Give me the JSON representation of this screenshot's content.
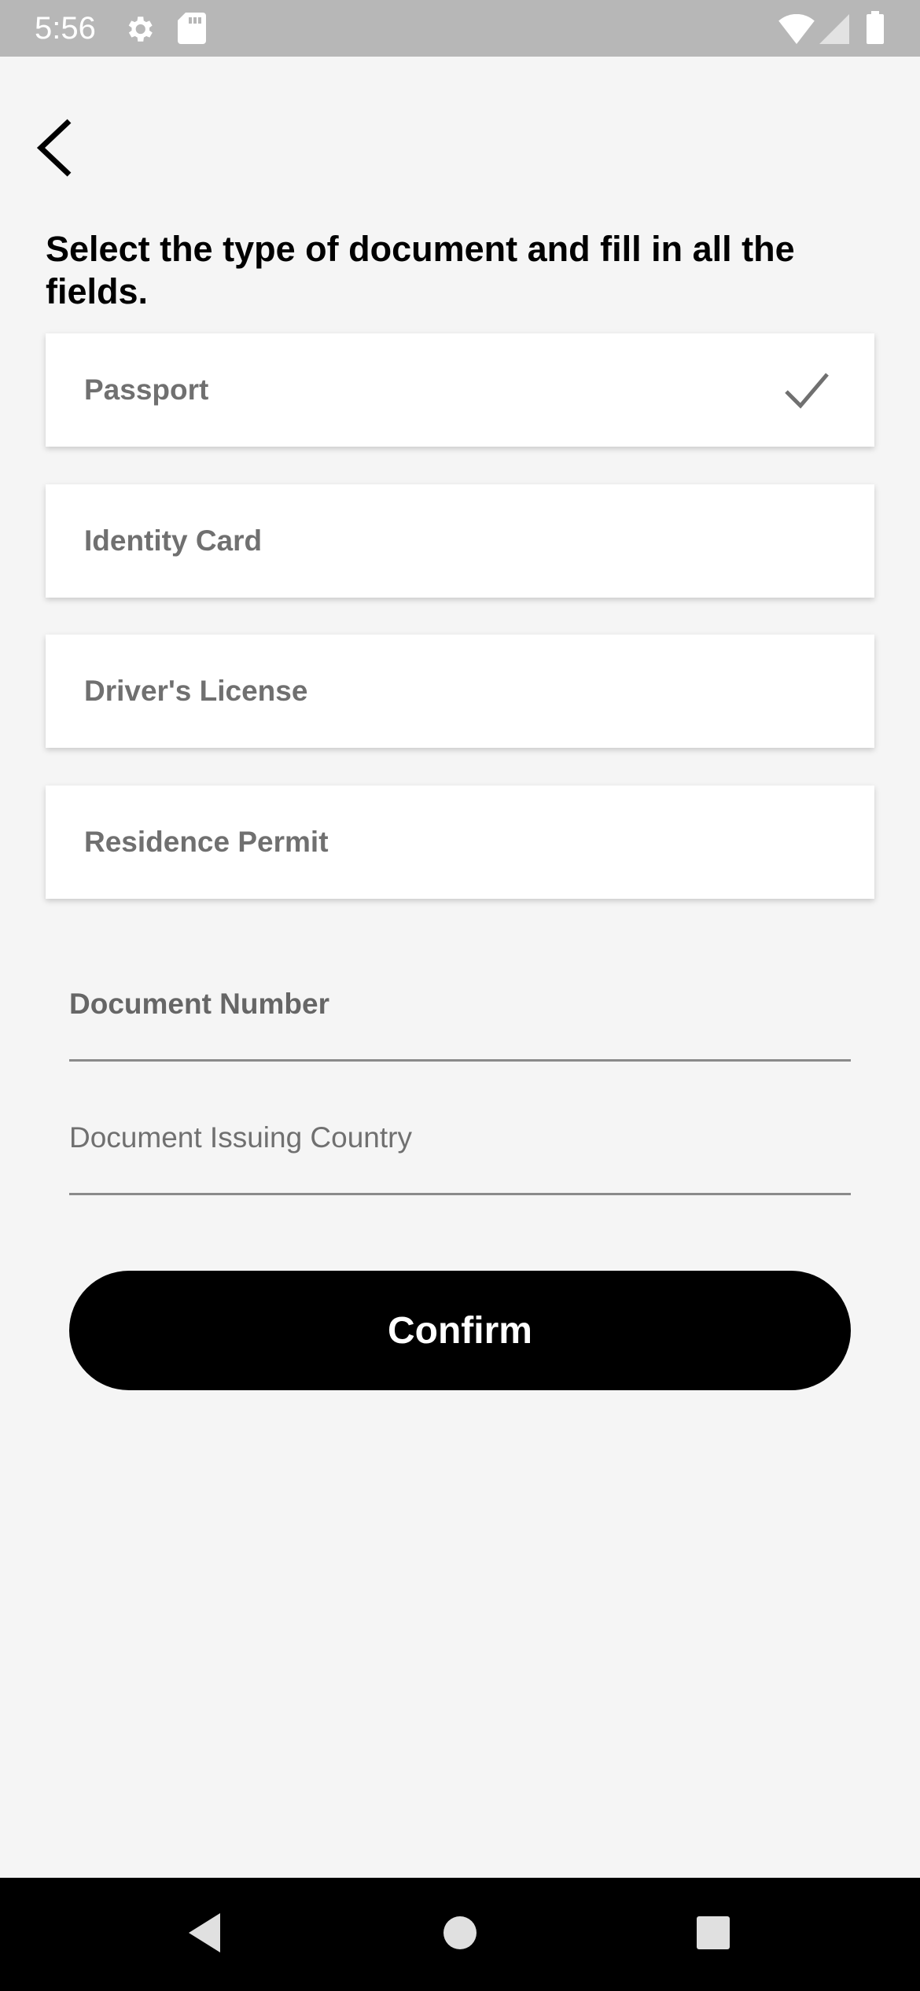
{
  "status_bar": {
    "time": "5:56",
    "icons": [
      "settings-icon",
      "sd-card-icon",
      "wifi-icon",
      "cellular-signal-icon",
      "battery-icon"
    ]
  },
  "header": {
    "back_icon": "chevron-left-icon"
  },
  "heading": "Select the type of document and fill in all the fields.",
  "document_types": [
    {
      "label": "Passport",
      "selected": true
    },
    {
      "label": "Identity Card",
      "selected": false
    },
    {
      "label": "Driver's License",
      "selected": false
    },
    {
      "label": "Residence Permit",
      "selected": false
    }
  ],
  "fields": {
    "document_number": {
      "label": "Document Number",
      "value": ""
    },
    "issuing_country": {
      "label": "Document Issuing Country",
      "value": ""
    }
  },
  "confirm_label": "Confirm",
  "nav_bar": {
    "icons": [
      "back-triangle-icon",
      "home-circle-icon",
      "recents-square-icon"
    ]
  },
  "colors": {
    "background": "#f5f5f5",
    "status_bar": "#b7b7b7",
    "primary_button": "#000000",
    "option_text": "#707070",
    "check": "#707070"
  }
}
